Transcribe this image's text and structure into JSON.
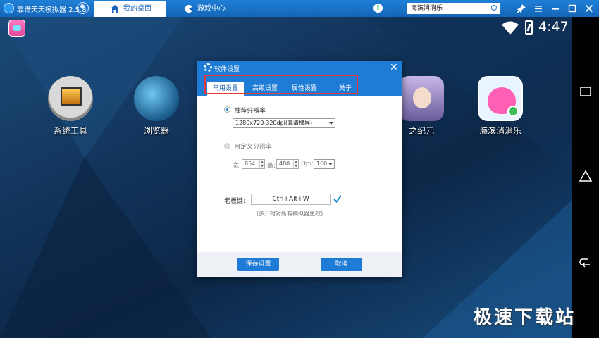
{
  "titlebar": {
    "title": "靠谱天天模拟器 2.5.8",
    "tabs": [
      {
        "label": "我的桌面",
        "active": true,
        "icon": "home-icon"
      },
      {
        "label": "游戏中心",
        "active": false,
        "icon": "game-center-icon"
      }
    ],
    "notice_glyph": "!",
    "search_value": "海滨消消乐",
    "controls": [
      "pin-icon",
      "menu-icon",
      "minimize-icon",
      "maximize-icon",
      "close-icon"
    ],
    "accent": "#1e7bd6"
  },
  "status_bar": {
    "time": "4:47",
    "icons": [
      "wifi-icon",
      "battery-icon"
    ]
  },
  "desktop": {
    "apps": [
      {
        "label": "系统工具",
        "icon": "system-tools-icon"
      },
      {
        "label": "浏览器",
        "icon": "browser-icon"
      },
      {
        "label": "之纪元",
        "icon": "game-era-icon"
      },
      {
        "label": "海滨消消乐",
        "icon": "candy-game-icon"
      }
    ]
  },
  "navbar": {
    "buttons": [
      "recents-icon",
      "home-icon",
      "back-icon"
    ]
  },
  "dialog": {
    "title": "软件设置",
    "tabs": [
      {
        "label": "常用设置",
        "active": true
      },
      {
        "label": "高级设置",
        "active": false
      },
      {
        "label": "属性设置",
        "active": false
      },
      {
        "label": "关于",
        "active": false
      }
    ],
    "recommended": {
      "label": "推荐分辨率",
      "selected": true,
      "value": "1280x720-320dpi(高清横屏)"
    },
    "custom": {
      "label": "自定义分辨率",
      "selected": false,
      "width_label": "宽:",
      "width": "854",
      "height_label": "高:",
      "height": "480",
      "dpi_label": "Dpi:",
      "dpi": "160"
    },
    "boss_key": {
      "label": "老板键:",
      "value": "Ctrl+Alt+W",
      "hint": "(多开时对所有模拟器生效)"
    },
    "save_label": "保存设置",
    "cancel_label": "取消",
    "highlight_color": "#e53b3b"
  },
  "watermark": "极速下载站"
}
